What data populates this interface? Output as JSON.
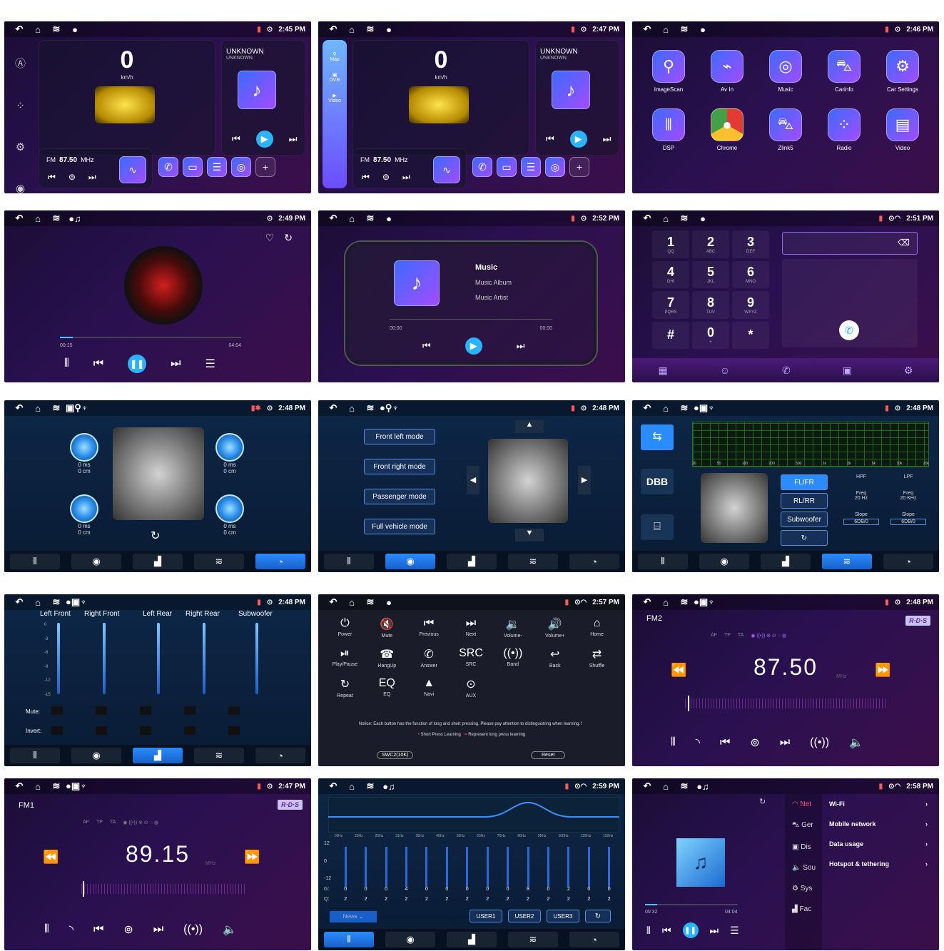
{
  "statusbar_icons": {
    "back": "↶",
    "home": "⌂",
    "layers": "≋",
    "dot": "●",
    "signal": "▮",
    "location": "⊙"
  },
  "panels": {
    "p1": {
      "time": "2:45 PM",
      "speed": "0",
      "speed_unit": "km/h",
      "song_title": "UNKNOWN",
      "song_sub": "UNKNOWN",
      "band": "FM",
      "freq": "87.50",
      "freq_unit": "MHz"
    },
    "p2": {
      "time": "2:47 PM",
      "speed": "0",
      "speed_unit": "km/h",
      "song_title": "UNKNOWN",
      "song_sub": "UNKNOWN",
      "band": "FM",
      "freq": "87.50",
      "freq_unit": "MHz",
      "side": [
        "Map",
        "DVR",
        "Video"
      ]
    },
    "p3": {
      "time": "2:46 PM",
      "apps": [
        "ImageScan",
        "Av In",
        "Music",
        "Carinfo",
        "Car Settings",
        "DSP",
        "Chrome",
        "Zlink5",
        "Radio",
        "Video"
      ]
    },
    "p4": {
      "time": "2:49 PM",
      "elapsed": "00:15",
      "total": "04:04"
    },
    "p5": {
      "time": "2:52 PM",
      "title": "Music",
      "album": "Music Album",
      "artist": "Music Artist",
      "t_start": "00:00",
      "t_end": "00:00"
    },
    "p6": {
      "time": "2:51 PM",
      "keys": [
        [
          "1",
          "QQ"
        ],
        [
          "2",
          "ABC"
        ],
        [
          "3",
          "DEF"
        ],
        [
          "4",
          "GHI"
        ],
        [
          "5",
          "JKL"
        ],
        [
          "6",
          "MNO"
        ],
        [
          "7",
          "PQRS"
        ],
        [
          "8",
          "TUV"
        ],
        [
          "9",
          "WXYZ"
        ],
        [
          "#",
          ""
        ],
        [
          "0",
          "+"
        ],
        [
          "*",
          ""
        ]
      ]
    },
    "p7": {
      "time": "2:48 PM",
      "knob_label": "0 ms",
      "knob_sub": "0 cm"
    },
    "p8": {
      "time": "2:48 PM",
      "modes": [
        "Front left mode",
        "Front right mode",
        "Passenger mode",
        "Full vehicle mode"
      ]
    },
    "p9": {
      "time": "2:48 PM",
      "dbb": "DBB",
      "buttons": [
        "FL/FR",
        "RL/RR",
        "Subwoofer"
      ],
      "hpf": "HPF",
      "lpf": "LPF",
      "freq": "Freq",
      "hpf_val": "20 Hz",
      "lpf_val": "20 KHz",
      "slope": "Slope",
      "slope_val": "6DB/0",
      "axis": [
        "20",
        "50",
        "100",
        "200",
        "500",
        "1k",
        "2k",
        "5k",
        "10k",
        "20k"
      ]
    },
    "p10": {
      "time": "2:48 PM",
      "channels": [
        "Left Front",
        "Right Front",
        "Left Rear",
        "Right Rear",
        "Subwoofer"
      ],
      "mute": "Mute:",
      "invert": "Invert:",
      "scale": [
        "0",
        "-3",
        "-6",
        "-9",
        "-12",
        "-15"
      ]
    },
    "p11": {
      "time": "2:57 PM",
      "controls": [
        [
          "⏻",
          "Power"
        ],
        [
          "🔇",
          "Mute"
        ],
        [
          "⏮",
          "Previous"
        ],
        [
          "⏭",
          "Next"
        ],
        [
          "🔉",
          "Volume-"
        ],
        [
          "🔊",
          "Volume+"
        ],
        [
          "⌂",
          "Home"
        ],
        [
          "⏯",
          "Play/Pause"
        ],
        [
          "☎",
          "HangUp"
        ],
        [
          "✆",
          "Answer"
        ],
        [
          "SRC",
          "SRC"
        ],
        [
          "((•))",
          "Band"
        ],
        [
          "↩",
          "Back"
        ],
        [
          "⇄",
          "Shuffle"
        ],
        [
          "↻",
          "Repeat"
        ],
        [
          "EQ",
          "EQ"
        ],
        [
          "▲",
          "Navi"
        ],
        [
          "⊙",
          "AUX"
        ]
      ],
      "notice": "Notice:  Each button has the function of long and short pressing. Please pay attention to distinguishing when learning.！",
      "short": "Short Press Learning",
      "long": "Represent long press learning",
      "swc": "SWC2(10K)",
      "reset": "Reset"
    },
    "p12": {
      "time": "2:48 PM",
      "band": "FM2",
      "rds": "R·D·S",
      "freq": "87.50",
      "unit": "MHz",
      "flags": [
        "AF",
        "TP",
        "TA"
      ]
    },
    "p13": {
      "time": "2:47 PM",
      "band": "FM1",
      "rds": "R·D·S",
      "freq": "89.15",
      "unit": "MHz",
      "flags": [
        "AF",
        "TP",
        "TA"
      ]
    },
    "p14": {
      "time": "2:59 PM",
      "bands": [
        "16Hz",
        "20Hz",
        "25Hz",
        "31Hz",
        "35Hz",
        "40Hz",
        "50Hz",
        "63Hz",
        "70Hz",
        "80Hz",
        "95Hz",
        "100Hz",
        "125Hz",
        "150Hz"
      ],
      "scale": [
        "12",
        "0",
        "-12"
      ],
      "g": [
        "0",
        "0",
        "0",
        "4",
        "0",
        "0",
        "0",
        "0",
        "0",
        "8",
        "0",
        "2",
        "0",
        "0"
      ],
      "q": [
        "2",
        "2",
        "2",
        "2",
        "2",
        "2",
        "2",
        "2",
        "2",
        "2",
        "2",
        "2",
        "2",
        "2"
      ],
      "preset": "News",
      "users": [
        "USER1",
        "USER2",
        "USER3"
      ],
      "gl": "G:",
      "ql": "Q:"
    },
    "p15": {
      "time": "2:58 PM",
      "elapsed": "00:32",
      "total": "04:04",
      "side": [
        "Net",
        "Ger",
        "Dis",
        "Sou",
        "Sys",
        "Fac"
      ],
      "rows": [
        "Wi-Fi",
        "Mobile network",
        "Data usage",
        "Hotspot & tethering"
      ]
    }
  }
}
